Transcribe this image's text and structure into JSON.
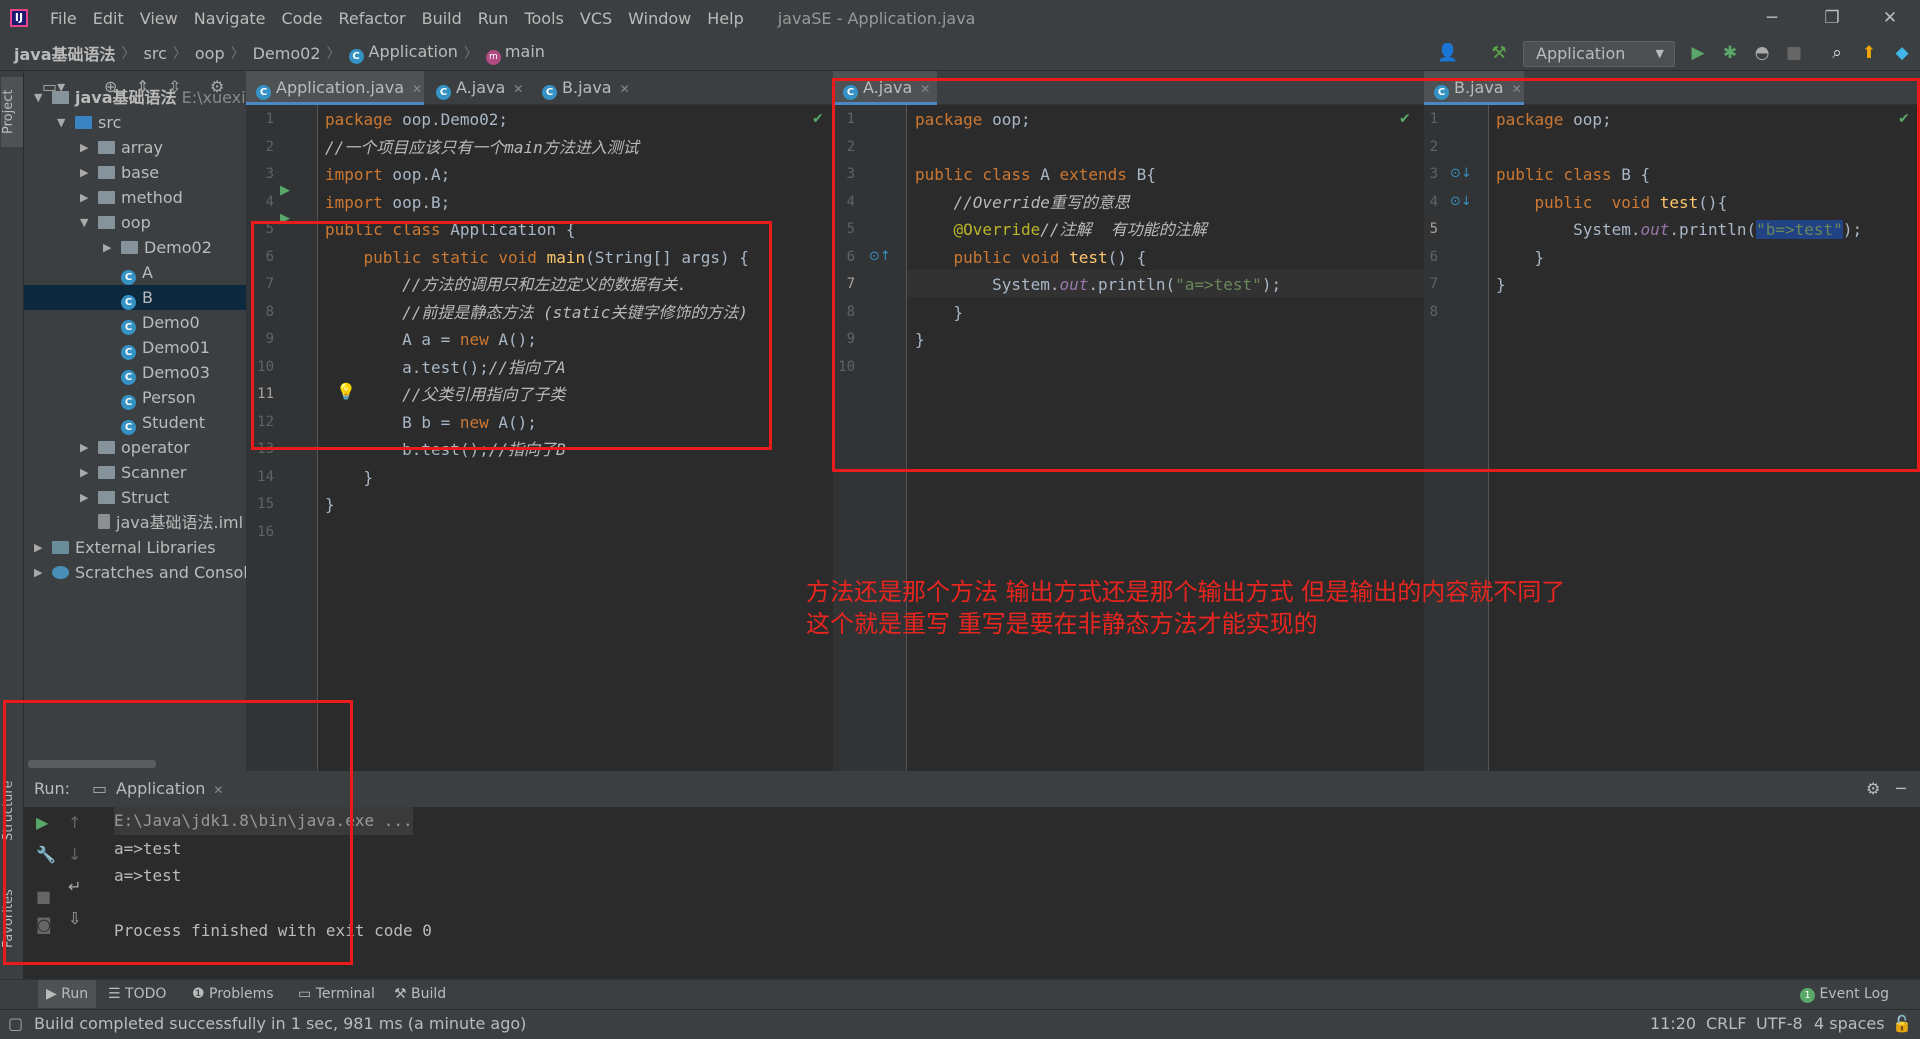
{
  "menu": {
    "items": [
      "File",
      "Edit",
      "View",
      "Navigate",
      "Code",
      "Refactor",
      "Build",
      "Run",
      "Tools",
      "VCS",
      "Window",
      "Help"
    ],
    "window_title": "javaSE - Application.java"
  },
  "navbar": {
    "crumbs": [
      "java基础语法",
      "src",
      "oop",
      "Demo02",
      "Application",
      "main"
    ],
    "run_config": "Application"
  },
  "sidebar": {
    "project_tab": "Project",
    "structure_tab": "Structure",
    "favorites_tab": "Favorites"
  },
  "project_tree": {
    "root": "java基础语法",
    "root_path": "E:\\xuexi\\",
    "items": [
      {
        "label": "src",
        "kind": "srcfolder",
        "indent": 1,
        "expanded": true
      },
      {
        "label": "array",
        "kind": "folder",
        "indent": 2,
        "expanded": false
      },
      {
        "label": "base",
        "kind": "folder",
        "indent": 2,
        "expanded": false
      },
      {
        "label": "method",
        "kind": "folder",
        "indent": 2,
        "expanded": false
      },
      {
        "label": "oop",
        "kind": "folder",
        "indent": 2,
        "expanded": true
      },
      {
        "label": "Demo02",
        "kind": "folder",
        "indent": 3,
        "expanded": false
      },
      {
        "label": "A",
        "kind": "class",
        "indent": 3
      },
      {
        "label": "B",
        "kind": "class",
        "indent": 3,
        "selected": true
      },
      {
        "label": "Demo0",
        "kind": "class",
        "indent": 3
      },
      {
        "label": "Demo01",
        "kind": "class",
        "indent": 3
      },
      {
        "label": "Demo03",
        "kind": "class",
        "indent": 3
      },
      {
        "label": "Person",
        "kind": "class",
        "indent": 3
      },
      {
        "label": "Student",
        "kind": "class",
        "indent": 3
      },
      {
        "label": "operator",
        "kind": "folder",
        "indent": 2,
        "expanded": false
      },
      {
        "label": "Scanner",
        "kind": "folder",
        "indent": 2,
        "expanded": false
      },
      {
        "label": "Struct",
        "kind": "folder",
        "indent": 2,
        "expanded": false
      },
      {
        "label": "java基础语法.iml",
        "kind": "iml",
        "indent": 2
      },
      {
        "label": "External Libraries",
        "kind": "lib",
        "indent": 0,
        "expanded": false
      },
      {
        "label": "Scratches and Consoles",
        "kind": "scratch",
        "indent": 0,
        "expanded": false
      }
    ]
  },
  "editor_left": {
    "tabs": [
      "Application.java",
      "A.java",
      "B.java"
    ],
    "line_numbers": [
      "1",
      "2",
      "3",
      "4",
      "5",
      "6",
      "7",
      "8",
      "9",
      "10",
      "11",
      "12",
      "13",
      "14",
      "15",
      "16"
    ]
  },
  "editor_mid": {
    "tabs": [
      "A.java"
    ],
    "line_numbers": [
      "1",
      "2",
      "3",
      "4",
      "5",
      "6",
      "7",
      "8",
      "9",
      "10"
    ]
  },
  "editor_right": {
    "tabs": [
      "B.java"
    ],
    "line_numbers": [
      "1",
      "2",
      "3",
      "4",
      "5",
      "6",
      "7",
      "8"
    ]
  },
  "annotation": {
    "line1": "方法还是那个方法  输出方式还是那个输出方式  但是输出的内容就不同了",
    "line2": "这个就是重写 重写是要在非静态方法才能实现的"
  },
  "run_panel": {
    "label": "Run:",
    "tab": "Application",
    "output": [
      "E:\\Java\\jdk1.8\\bin\\java.exe ...",
      "a=>test",
      "a=>test",
      "",
      "Process finished with exit code 0"
    ]
  },
  "bottom_tabs": {
    "run": "Run",
    "todo": "TODO",
    "problems": "Problems",
    "terminal": "Terminal",
    "build": "Build",
    "event_log": "Event Log",
    "event_count": "1"
  },
  "status": {
    "message": "Build completed successfully in 1 sec, 981 ms (a minute ago)",
    "position": "11:20",
    "line_sep": "CRLF",
    "encoding": "UTF-8",
    "indent": "4 spaces"
  },
  "colors": {
    "keyword": "#cc7832",
    "string": "#6a8759",
    "comment": "#b9b9b9",
    "method": "#ffc66d",
    "annotation": "#bbb529",
    "static_field": "#9876aa",
    "highlight_box": "#ea1b1b",
    "note_text": "#e8251f"
  }
}
